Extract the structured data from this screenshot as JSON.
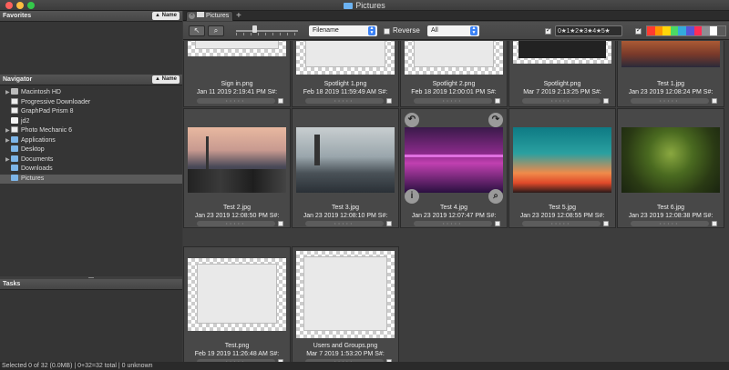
{
  "window": {
    "title": "Pictures"
  },
  "panels": {
    "favorites": {
      "title": "Favorites",
      "sort_label": "▲ Name"
    },
    "navigator": {
      "title": "Navigator",
      "sort_label": "▲ Name",
      "items": [
        {
          "label": "Macintosh HD",
          "icon": "disk-icon",
          "expandable": true
        },
        {
          "label": "Progressive Downloader",
          "icon": "app-icon",
          "expandable": false
        },
        {
          "label": "GraphPad Prism 8",
          "icon": "app-icon",
          "expandable": false
        },
        {
          "label": "jd2",
          "icon": "document-icon",
          "expandable": false
        },
        {
          "label": "Photo Mechanic 6",
          "icon": "app-icon",
          "expandable": true
        },
        {
          "label": "Applications",
          "icon": "folder-icon",
          "expandable": true
        },
        {
          "label": "Desktop",
          "icon": "folder-icon",
          "expandable": false
        },
        {
          "label": "Documents",
          "icon": "folder-icon",
          "expandable": true
        },
        {
          "label": "Downloads",
          "icon": "folder-icon",
          "expandable": false
        },
        {
          "label": "Pictures",
          "icon": "folder-icon",
          "expandable": false,
          "selected": true
        }
      ]
    },
    "tasks": {
      "title": "Tasks"
    }
  },
  "tabs": [
    {
      "label": "Pictures"
    }
  ],
  "toolbar": {
    "sort_field": "Filename",
    "reverse_label": "Reverse",
    "filter": "All",
    "star_filter": "0★1★2★3★4★5★",
    "color_swatches": [
      "#ff3b30",
      "#ff9500",
      "#ffd60a",
      "#4cd964",
      "#34aadc",
      "#5856d6",
      "#ff2d55",
      "#8e8e93",
      "#ffffff",
      "#5a5a5a"
    ]
  },
  "grid": {
    "row1": [
      {
        "name": "Sign in.png",
        "date": "Jan 11 2019 2:19:41 PM S#:"
      },
      {
        "name": "Spotlight 1.png",
        "date": "Feb 18 2019 11:59:49 AM S#:"
      },
      {
        "name": "Spotlight 2.png",
        "date": "Feb 18 2019 12:00:01 PM S#:"
      },
      {
        "name": "Spotlight.png",
        "date": "Mar 7 2019 2:13:25 PM S#:"
      },
      {
        "name": "Test 1.jpg",
        "date": "Jan 23 2019 12:08:24 PM S#:"
      }
    ],
    "row2": [
      {
        "name": "Test 2.jpg",
        "date": "Jan 23 2019 12:08:50 PM S#:"
      },
      {
        "name": "Test 3.jpg",
        "date": "Jan 23 2019 12:08:10 PM S#:"
      },
      {
        "name": "Test 4.jpg",
        "date": "Jan 23 2019 12:07:47 PM S#:"
      },
      {
        "name": "Test 5.jpg",
        "date": "Jan 23 2019 12:08:55 PM S#:"
      },
      {
        "name": "Test 6.jpg",
        "date": "Jan 23 2019 12:08:38 PM S#:"
      }
    ],
    "row3": [
      {
        "name": "Test.png",
        "date": "Feb 19 2019 11:26:48 AM S#:"
      },
      {
        "name": "Users and Groups.png",
        "date": "Mar 7 2019 1:53:20 PM S#:"
      }
    ]
  },
  "status": "Selected 0 of 32 (0.0MB) | 0+32=32 total | 0 unknown"
}
